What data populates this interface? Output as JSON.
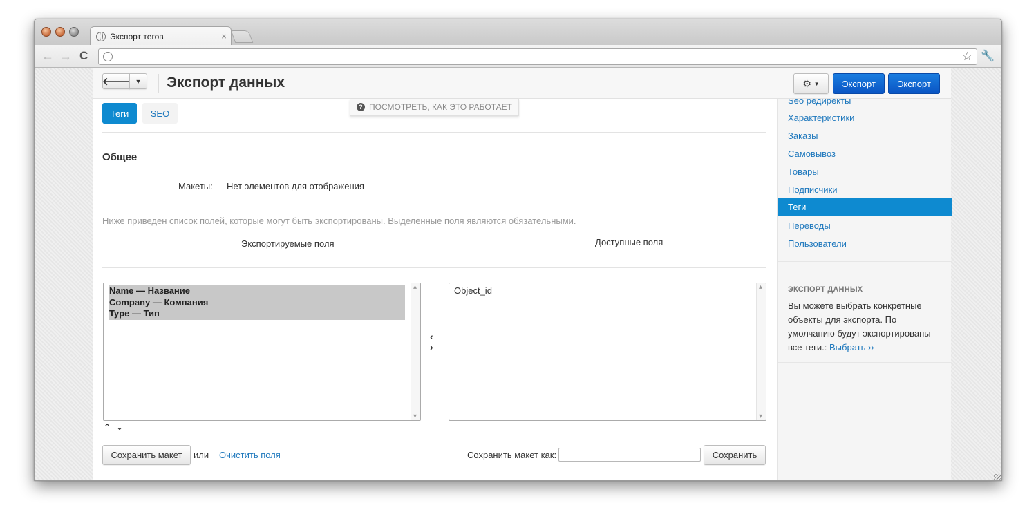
{
  "browser": {
    "tab_title": "Экспорт тегов",
    "tab_close": "×",
    "url": ""
  },
  "header": {
    "title": "Экспорт данных",
    "export_button_1": "Экспорт",
    "export_button_2": "Экспорт",
    "howto": "ПОСМОТРЕТЬ, КАК ЭТО РАБОТАЕТ"
  },
  "tabs": [
    {
      "label": "Теги",
      "active": true
    },
    {
      "label": "SEO",
      "active": false
    }
  ],
  "general": {
    "title": "Общее",
    "layouts_label": "Макеты:",
    "layouts_value": "Нет элементов для отображения",
    "description": "Ниже приведен список полей, которые могут быть экспортированы. Выделенные поля являются обязательными.",
    "exported_fields_header": "Экспортируемые поля",
    "available_fields_header": "Доступные поля"
  },
  "exported_fields": [
    "Name — Название",
    "Company — Компания",
    "Type — Тип"
  ],
  "available_fields": [
    "Object_id"
  ],
  "footer": {
    "save_layout_button": "Сохранить макет",
    "or_text": "или",
    "clear_fields_link": "Очистить поля",
    "save_as_label": "Сохранить макет как:",
    "save_as_value": "",
    "save_button": "Сохранить"
  },
  "sidebar": {
    "items": [
      {
        "label": "Seo редиректы",
        "active": false
      },
      {
        "label": "Характеристики",
        "active": false
      },
      {
        "label": "Заказы",
        "active": false
      },
      {
        "label": "Самовывоз",
        "active": false
      },
      {
        "label": "Товары",
        "active": false
      },
      {
        "label": "Подписчики",
        "active": false
      },
      {
        "label": "Теги",
        "active": true
      },
      {
        "label": "Переводы",
        "active": false
      },
      {
        "label": "Пользователи",
        "active": false
      }
    ],
    "info_title": "ЭКСПОРТ ДАННЫХ",
    "info_text": "Вы можете выбрать конкретные объекты для экспорта. По умолчанию будут экспортированы все теги.:",
    "info_link": "Выбрать ››"
  },
  "colors": {
    "accent": "#0e8ad0",
    "primary_button": "#0a55c4",
    "link": "#1e78bd"
  }
}
